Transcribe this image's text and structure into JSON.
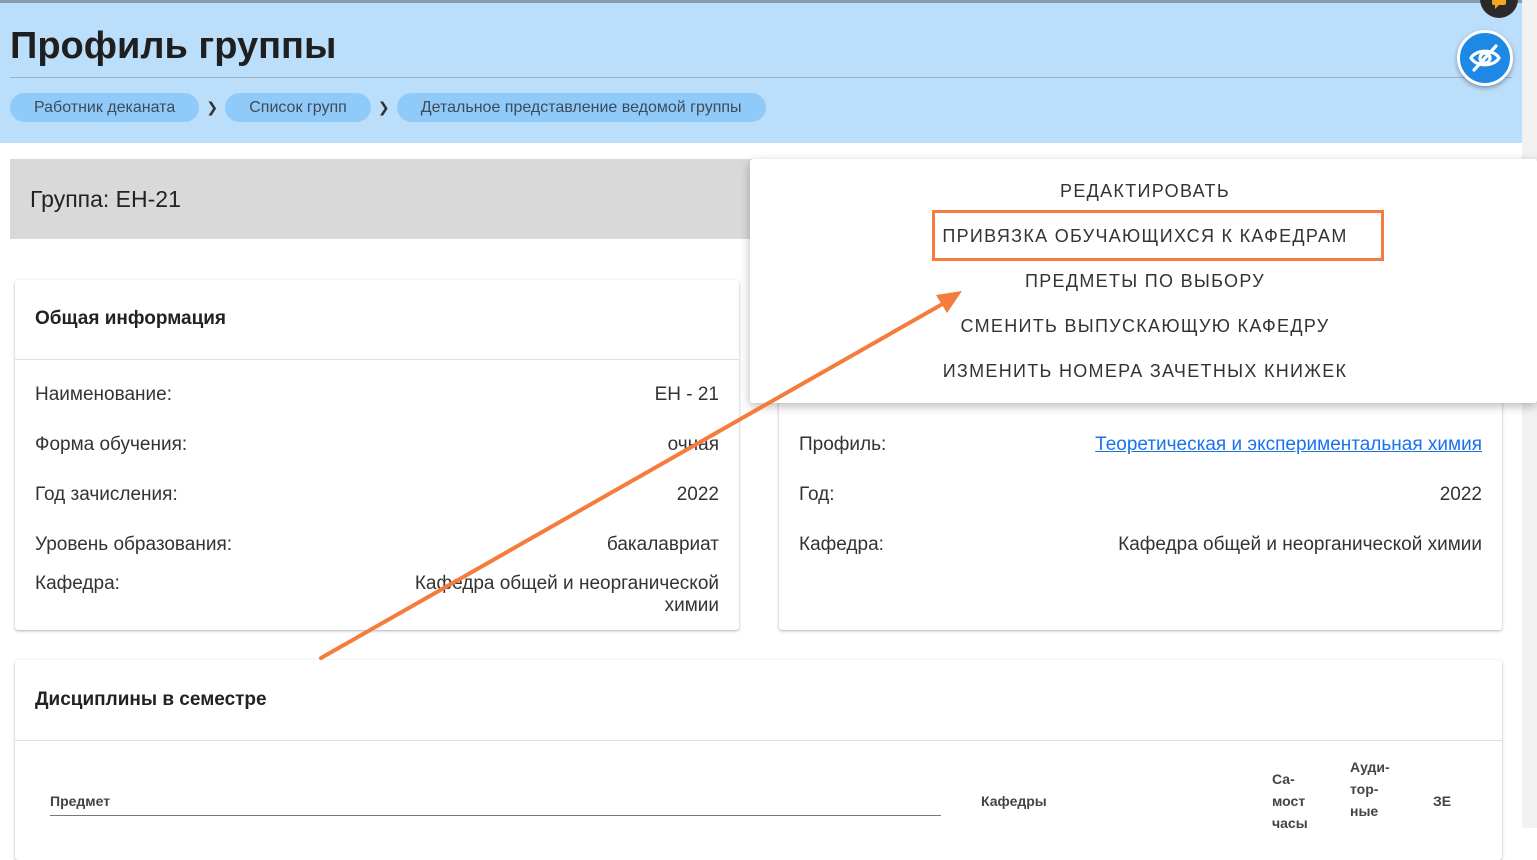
{
  "header": {
    "title": "Профиль группы",
    "breadcrumbs": [
      {
        "label": "Работник деканата"
      },
      {
        "label": "Список групп"
      },
      {
        "label": "Детальное представление ведомой группы"
      }
    ],
    "breadcrumb_separator": "❯"
  },
  "group_bar": {
    "title": "Группа: ЕН-21"
  },
  "general_info": {
    "title": "Общая информация",
    "rows": [
      {
        "label": "Наименование:",
        "value": "ЕН - 21"
      },
      {
        "label": "Форма обучения:",
        "value": "очная"
      },
      {
        "label": "Год зачисления:",
        "value": "2022"
      },
      {
        "label": "Уровень образования:",
        "value": "бакалавриат"
      },
      {
        "label": "Кафедра:",
        "value_line1": "Кафедра общей и неорганической",
        "value_line2": "химии"
      }
    ]
  },
  "profile_info": {
    "rows": [
      {
        "label": "Профиль:",
        "value": "Теоретическая и экспериментальная химия"
      },
      {
        "label": "Год:",
        "value": "2022"
      },
      {
        "label": "Кафедра:",
        "value": "Кафедра общей и неорганической химии"
      }
    ]
  },
  "actions_menu": {
    "items": [
      {
        "label": "Редактировать"
      },
      {
        "label": "Привязка обучающихся к кафедрам",
        "highlighted": true
      },
      {
        "label": "Предметы по выбору"
      },
      {
        "label": "Сменить выпускающую кафедру"
      },
      {
        "label": "Изменить номера зачетных книжек"
      }
    ]
  },
  "disciplines": {
    "title": "Дисциплины в семестре",
    "columns": {
      "subject": "Предмет",
      "departments": "Кафедры",
      "self_hours": [
        "Са-",
        "мост",
        "часы"
      ],
      "aud_hours": [
        "Ауди-",
        "тор-",
        "ные"
      ],
      "credits": "ЗЕ"
    }
  },
  "colors": {
    "header_bg": "#bbdefb",
    "breadcrumb_bg": "#90caf9",
    "accent_blue": "#1e88e5",
    "highlight_orange": "#f47c3c",
    "link": "#1a73e8"
  },
  "icons": {
    "visibility_toggle": "eye-off-icon",
    "chat": "chat-icon",
    "annotation": "arrow-annotation"
  }
}
